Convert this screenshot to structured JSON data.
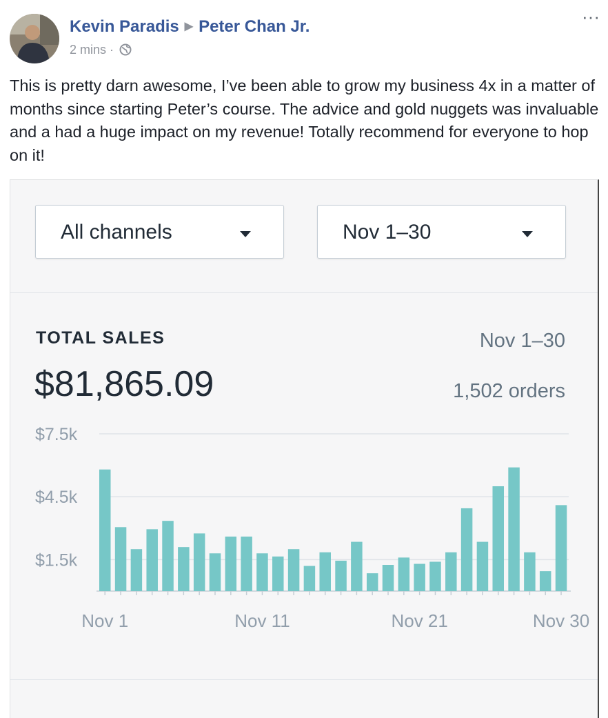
{
  "post": {
    "author": "Kevin Paradis",
    "recipient": "Peter Chan Jr.",
    "timestamp": "2 mins",
    "separator": "·",
    "more_label": "···",
    "text": "This is pretty darn awesome, I’ve been able to grow my business 4x in a matter of months since starting Peter’s course. The advice and gold nuggets was invaluable and a had a huge impact on my revenue! Totally recommend for everyone to hop on it!"
  },
  "dashboard": {
    "channel_select": "All channels",
    "date_select": "Nov 1–30",
    "total_label": "TOTAL SALES",
    "total_value": "$81,865.09",
    "range": "Nov 1–30",
    "orders": "1,502 orders"
  },
  "colors": {
    "bar": "#76c7c7",
    "link": "#385898",
    "grid": "#dfe3e8"
  },
  "chart_data": {
    "type": "bar",
    "x": [
      "Nov 1",
      "Nov 2",
      "Nov 3",
      "Nov 4",
      "Nov 5",
      "Nov 6",
      "Nov 7",
      "Nov 8",
      "Nov 9",
      "Nov 10",
      "Nov 11",
      "Nov 12",
      "Nov 13",
      "Nov 14",
      "Nov 15",
      "Nov 16",
      "Nov 17",
      "Nov 18",
      "Nov 19",
      "Nov 20",
      "Nov 21",
      "Nov 22",
      "Nov 23",
      "Nov 24",
      "Nov 25",
      "Nov 26",
      "Nov 27",
      "Nov 28",
      "Nov 29",
      "Nov 30"
    ],
    "values": [
      5800,
      3050,
      2000,
      2950,
      3350,
      2100,
      2750,
      1800,
      2600,
      2600,
      1800,
      1650,
      2000,
      1200,
      1850,
      1450,
      2350,
      850,
      1250,
      1600,
      1300,
      1400,
      1850,
      3950,
      2350,
      5000,
      5900,
      1850,
      950,
      4100
    ],
    "yticks": [
      7500,
      4500,
      1500
    ],
    "ytick_labels": [
      "$7.5k",
      "$4.5k",
      "$1.5k"
    ],
    "xtick_labels": [
      "Nov 1",
      "Nov 11",
      "Nov 21",
      "Nov 30"
    ],
    "xtick_days": [
      1,
      11,
      21,
      30
    ],
    "ylim": [
      0,
      7500
    ],
    "grid": true
  }
}
